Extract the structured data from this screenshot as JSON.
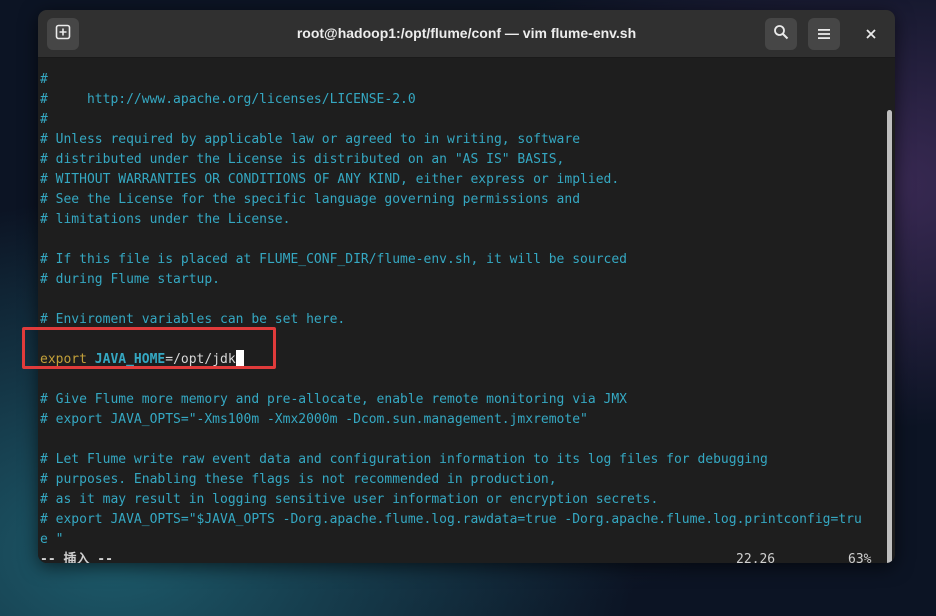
{
  "window": {
    "title": "root@hadoop1:/opt/flume/conf — vim flume-env.sh",
    "icons": {
      "new_tab": "new-tab-icon",
      "search": "search-icon",
      "menu": "hamburger-menu-icon",
      "close": "close-icon"
    }
  },
  "editor": {
    "lines": [
      "#",
      "#     http://www.apache.org/licenses/LICENSE-2.0",
      "#",
      "# Unless required by applicable law or agreed to in writing, software",
      "# distributed under the License is distributed on an \"AS IS\" BASIS,",
      "# WITHOUT WARRANTIES OR CONDITIONS OF ANY KIND, either express or implied.",
      "# See the License for the specific language governing permissions and",
      "# limitations under the License.",
      "",
      "# If this file is placed at FLUME_CONF_DIR/flume-env.sh, it will be sourced",
      "# during Flume startup.",
      "",
      "# Enviroment variables can be set here.",
      "",
      "",
      "",
      "# Give Flume more memory and pre-allocate, enable remote monitoring via JMX",
      "# export JAVA_OPTS=\"-Xms100m -Xmx2000m -Dcom.sun.management.jmxremote\"",
      "",
      "# Let Flume write raw event data and configuration information to its log files for debugging",
      "# purposes. Enabling these flags is not recommended in production,",
      "# as it may result in logging sensitive user information or encryption secrets.",
      "# export JAVA_OPTS=\"$JAVA_OPTS -Dorg.apache.flume.log.rawdata=true -Dorg.apache.flume.log.printconfig=tru",
      "e \""
    ],
    "export_line": {
      "keyword": "export",
      "variable": "JAVA_HOME",
      "value": "=/opt/jdk"
    }
  },
  "statusbar": {
    "mode": "-- 插入 --",
    "position": "22,26",
    "percent": "63%"
  },
  "colors": {
    "comment": "#35a8c2",
    "keyword": "#c3a03a",
    "highlight_border": "#e03b3b"
  }
}
